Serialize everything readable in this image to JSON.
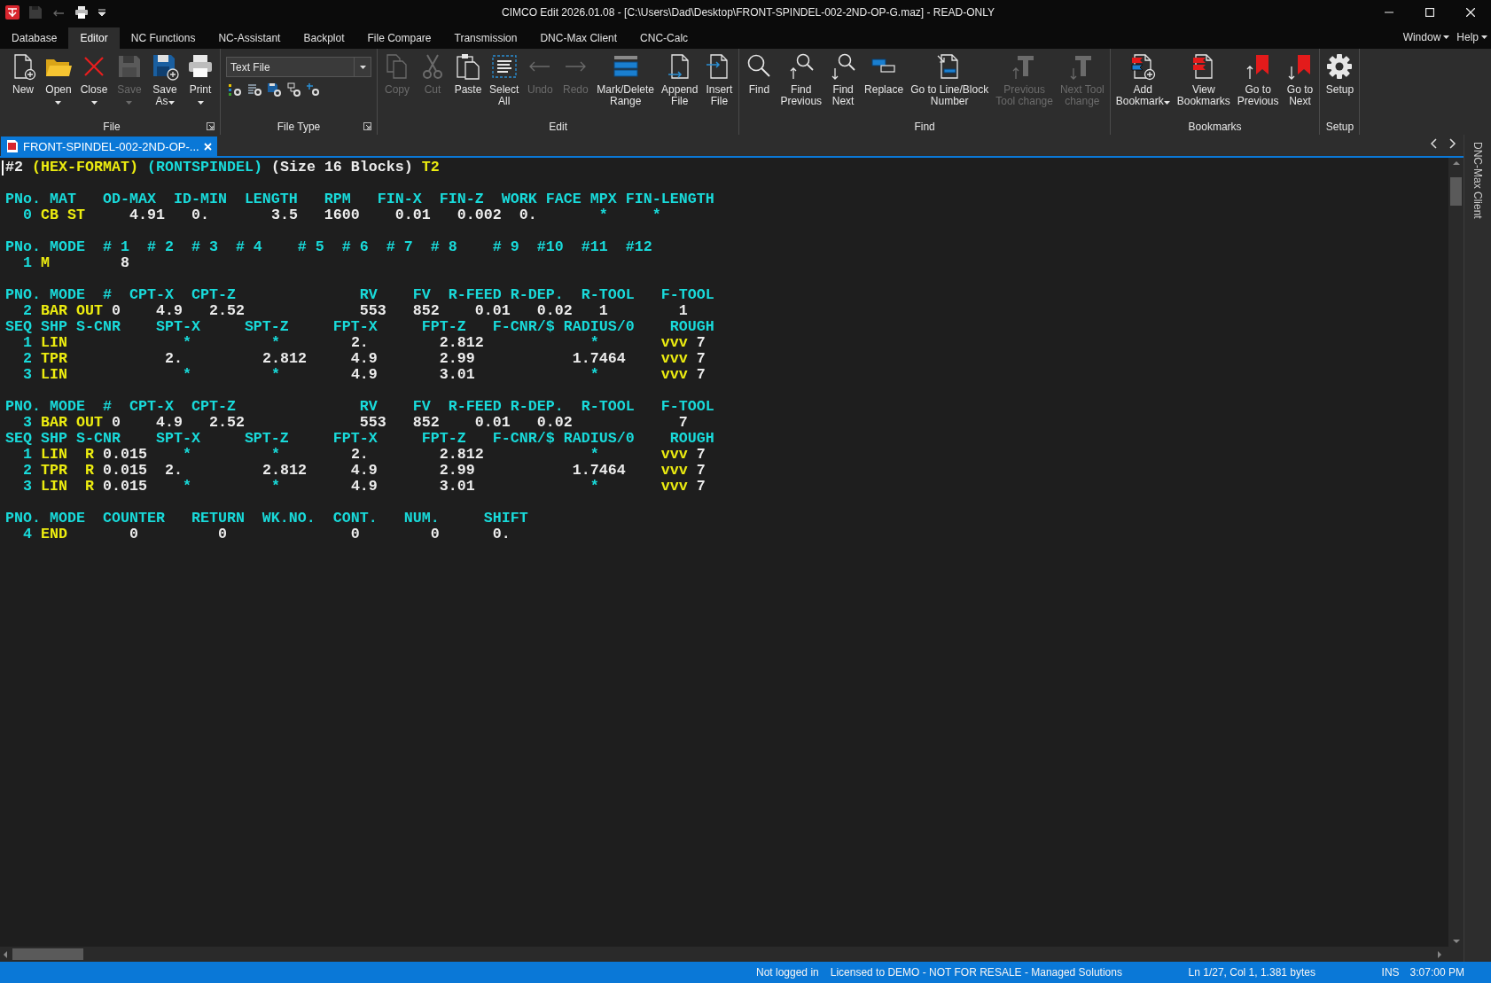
{
  "window": {
    "title": "CIMCO Edit 2026.01.08 - [C:\\Users\\Dad\\Desktop\\FRONT-SPINDEL-002-2ND-OP-G.maz] - READ-ONLY"
  },
  "menu_tabs": [
    {
      "label": "Database",
      "selected": false
    },
    {
      "label": "Editor",
      "selected": true
    },
    {
      "label": "NC Functions",
      "selected": false
    },
    {
      "label": "NC-Assistant",
      "selected": false
    },
    {
      "label": "Backplot",
      "selected": false
    },
    {
      "label": "File Compare",
      "selected": false
    },
    {
      "label": "Transmission",
      "selected": false
    },
    {
      "label": "DNC-Max Client",
      "selected": false
    },
    {
      "label": "CNC-Calc",
      "selected": false
    }
  ],
  "menu_right": [
    {
      "label": "Window"
    },
    {
      "label": "Help"
    }
  ],
  "ribbon": {
    "groups": [
      {
        "kind": "buttons",
        "title": "File",
        "launcher": true,
        "items": [
          {
            "label": "New",
            "disabled": false,
            "dropdown": false
          },
          {
            "label": "Open",
            "disabled": false,
            "dropdown": true
          },
          {
            "label": "Close",
            "disabled": false,
            "dropdown": true
          },
          {
            "label": "Save",
            "disabled": true,
            "dropdown": true
          },
          {
            "label": "Save\nAs",
            "disabled": false,
            "dropdown": true
          },
          {
            "label": "Print",
            "disabled": false,
            "dropdown": true
          }
        ]
      },
      {
        "kind": "file_type",
        "title": "File Type",
        "launcher": true,
        "value": "Text File"
      },
      {
        "kind": "buttons",
        "title": "Edit",
        "launcher": false,
        "items": [
          {
            "label": "Copy",
            "disabled": true,
            "dropdown": false
          },
          {
            "label": "Cut",
            "disabled": true,
            "dropdown": false
          },
          {
            "label": "Paste",
            "disabled": false,
            "dropdown": false
          },
          {
            "label": "Select\nAll",
            "disabled": false,
            "dropdown": false
          },
          {
            "label": "Undo",
            "disabled": true,
            "dropdown": false
          },
          {
            "label": "Redo",
            "disabled": true,
            "dropdown": false
          },
          {
            "label": "Mark/Delete\nRange",
            "disabled": false,
            "dropdown": false
          },
          {
            "label": "Append\nFile",
            "disabled": false,
            "dropdown": false
          },
          {
            "label": "Insert\nFile",
            "disabled": false,
            "dropdown": false
          }
        ]
      },
      {
        "kind": "buttons",
        "title": "Find",
        "launcher": false,
        "items": [
          {
            "label": "Find",
            "disabled": false,
            "dropdown": false
          },
          {
            "label": "Find\nPrevious",
            "disabled": false,
            "dropdown": false
          },
          {
            "label": "Find\nNext",
            "disabled": false,
            "dropdown": false
          },
          {
            "label": "Replace",
            "disabled": false,
            "dropdown": false
          },
          {
            "label": "Go to Line/Block\nNumber",
            "disabled": false,
            "dropdown": false
          },
          {
            "label": "Previous\nTool change",
            "disabled": true,
            "dropdown": false
          },
          {
            "label": "Next Tool\nchange",
            "disabled": true,
            "dropdown": false
          }
        ]
      },
      {
        "kind": "buttons",
        "title": "Bookmarks",
        "launcher": false,
        "items": [
          {
            "label": "Add\nBookmark",
            "disabled": false,
            "dropdown": true
          },
          {
            "label": "View\nBookmarks",
            "disabled": false,
            "dropdown": false
          },
          {
            "label": "Go to\nPrevious",
            "disabled": false,
            "dropdown": false
          },
          {
            "label": "Go to\nNext",
            "disabled": false,
            "dropdown": false
          }
        ]
      },
      {
        "kind": "buttons",
        "title": "Setup",
        "launcher": false,
        "items": [
          {
            "label": "Setup",
            "disabled": false,
            "dropdown": false
          }
        ]
      }
    ]
  },
  "documents": [
    {
      "title": "FRONT-SPINDEL-002-2ND-OP-...",
      "selected": true
    }
  ],
  "side_panel": {
    "label": "DNC-Max Client"
  },
  "editor": {
    "lines": [
      {
        "kind": "code",
        "segments": [
          {
            "text": "#2 ",
            "kind": "plain"
          },
          {
            "text": "(HEX-FORMAT) ",
            "kind": "name"
          },
          {
            "text": "(RONTSPINDEL)",
            "kind": "keyword"
          },
          {
            "text": " (Size 16 Blocks) ",
            "kind": "plain"
          },
          {
            "text": "T2",
            "kind": "name"
          }
        ]
      },
      {
        "kind": "blank"
      },
      {
        "kind": "code",
        "segments": [
          {
            "text": "PNo. MAT   OD-MAX  ID-MIN  LENGTH   RPM   FIN-X  FIN-Z  WORK FACE MPX FIN-LENGTH",
            "kind": "keyword"
          }
        ]
      },
      {
        "kind": "code",
        "segments": [
          {
            "text": "  0 ",
            "kind": "keyword"
          },
          {
            "text": "CB ST     ",
            "kind": "name"
          },
          {
            "text": "4.91   0.       3.5   1600    0.01   0.002  0.       ",
            "kind": "plain"
          },
          {
            "text": "*     *",
            "kind": "keyword"
          }
        ]
      },
      {
        "kind": "blank"
      },
      {
        "kind": "code",
        "segments": [
          {
            "text": "PNo. MODE  # 1  # 2  # 3  # 4    # 5  # 6  # 7  # 8    # 9  #10  #11  #12",
            "kind": "keyword"
          }
        ]
      },
      {
        "kind": "code",
        "segments": [
          {
            "text": "  1 ",
            "kind": "keyword"
          },
          {
            "text": "M        ",
            "kind": "name"
          },
          {
            "text": "8",
            "kind": "plain"
          }
        ]
      },
      {
        "kind": "blank"
      },
      {
        "kind": "code",
        "segments": [
          {
            "text": "PNO. MODE  #  CPT-X  CPT-Z              RV    FV  R-FEED R-DEP.  R-TOOL   F-TOOL",
            "kind": "keyword"
          }
        ]
      },
      {
        "kind": "code",
        "segments": [
          {
            "text": "  2 ",
            "kind": "keyword"
          },
          {
            "text": "BAR OUT ",
            "kind": "name"
          },
          {
            "text": "0    4.9   2.52             553   852    0.01   0.02   1        1",
            "kind": "plain"
          }
        ]
      },
      {
        "kind": "code",
        "segments": [
          {
            "text": "SEQ SHP S-CNR    SPT-X     SPT-Z     FPT-X     FPT-Z   F-CNR/$ RADIUS/0    ROUGH",
            "kind": "keyword"
          }
        ]
      },
      {
        "kind": "code",
        "segments": [
          {
            "text": "  1 ",
            "kind": "keyword"
          },
          {
            "text": "LIN",
            "kind": "name"
          },
          {
            "text": "             *         *",
            "kind": "keyword"
          },
          {
            "text": "        2.        2.812",
            "kind": "plain"
          },
          {
            "text": "            *       ",
            "kind": "keyword"
          },
          {
            "text": "vvv",
            "kind": "name"
          },
          {
            "text": " 7",
            "kind": "plain"
          }
        ]
      },
      {
        "kind": "code",
        "segments": [
          {
            "text": "  2 ",
            "kind": "keyword"
          },
          {
            "text": "TPR",
            "kind": "name"
          },
          {
            "text": "           2.         2.812     4.9       2.99           1.7464    ",
            "kind": "plain"
          },
          {
            "text": "vvv",
            "kind": "name"
          },
          {
            "text": " 7",
            "kind": "plain"
          }
        ]
      },
      {
        "kind": "code",
        "segments": [
          {
            "text": "  3 ",
            "kind": "keyword"
          },
          {
            "text": "LIN",
            "kind": "name"
          },
          {
            "text": "             *         *",
            "kind": "keyword"
          },
          {
            "text": "        4.9       3.01",
            "kind": "plain"
          },
          {
            "text": "             *       ",
            "kind": "keyword"
          },
          {
            "text": "vvv",
            "kind": "name"
          },
          {
            "text": " 7",
            "kind": "plain"
          }
        ]
      },
      {
        "kind": "blank"
      },
      {
        "kind": "code",
        "segments": [
          {
            "text": "PNO. MODE  #  CPT-X  CPT-Z              RV    FV  R-FEED R-DEP.  R-TOOL   F-TOOL",
            "kind": "keyword"
          }
        ]
      },
      {
        "kind": "code",
        "segments": [
          {
            "text": "  3 ",
            "kind": "keyword"
          },
          {
            "text": "BAR OUT ",
            "kind": "name"
          },
          {
            "text": "0    4.9   2.52             553   852    0.01   0.02            7",
            "kind": "plain"
          }
        ]
      },
      {
        "kind": "code",
        "segments": [
          {
            "text": "SEQ SHP S-CNR    SPT-X     SPT-Z     FPT-X     FPT-Z   F-CNR/$ RADIUS/0    ROUGH",
            "kind": "keyword"
          }
        ]
      },
      {
        "kind": "code",
        "segments": [
          {
            "text": "  1 ",
            "kind": "keyword"
          },
          {
            "text": "LIN  R ",
            "kind": "name"
          },
          {
            "text": "0.015    ",
            "kind": "plain"
          },
          {
            "text": "*         *",
            "kind": "keyword"
          },
          {
            "text": "        2.        2.812",
            "kind": "plain"
          },
          {
            "text": "            *       ",
            "kind": "keyword"
          },
          {
            "text": "vvv",
            "kind": "name"
          },
          {
            "text": " 7",
            "kind": "plain"
          }
        ]
      },
      {
        "kind": "code",
        "segments": [
          {
            "text": "  2 ",
            "kind": "keyword"
          },
          {
            "text": "TPR  R ",
            "kind": "name"
          },
          {
            "text": "0.015  2.         2.812     4.9       2.99           1.7464    ",
            "kind": "plain"
          },
          {
            "text": "vvv",
            "kind": "name"
          },
          {
            "text": " 7",
            "kind": "plain"
          }
        ]
      },
      {
        "kind": "code",
        "segments": [
          {
            "text": "  3 ",
            "kind": "keyword"
          },
          {
            "text": "LIN  R ",
            "kind": "name"
          },
          {
            "text": "0.015    ",
            "kind": "plain"
          },
          {
            "text": "*         *",
            "kind": "keyword"
          },
          {
            "text": "        4.9       3.01",
            "kind": "plain"
          },
          {
            "text": "             *       ",
            "kind": "keyword"
          },
          {
            "text": "vvv",
            "kind": "name"
          },
          {
            "text": " 7",
            "kind": "plain"
          }
        ]
      },
      {
        "kind": "blank"
      },
      {
        "kind": "code",
        "segments": [
          {
            "text": "PNO. MODE  COUNTER   RETURN  WK.NO.  CONT.   NUM.     SHIFT",
            "kind": "keyword"
          }
        ]
      },
      {
        "kind": "code",
        "segments": [
          {
            "text": "  4 ",
            "kind": "keyword"
          },
          {
            "text": "END",
            "kind": "name"
          },
          {
            "text": "       0         0              0        0      0.",
            "kind": "plain"
          }
        ]
      }
    ]
  },
  "status_bar": [
    {
      "text": "Not logged in"
    },
    {
      "text": "Licensed to DEMO - NOT FOR RESALE - Managed Solutions"
    },
    {
      "text": "Ln 1/27, Col 1, 1.381 bytes"
    },
    {
      "text": "INS"
    },
    {
      "text": "3:07:00 PM"
    }
  ]
}
